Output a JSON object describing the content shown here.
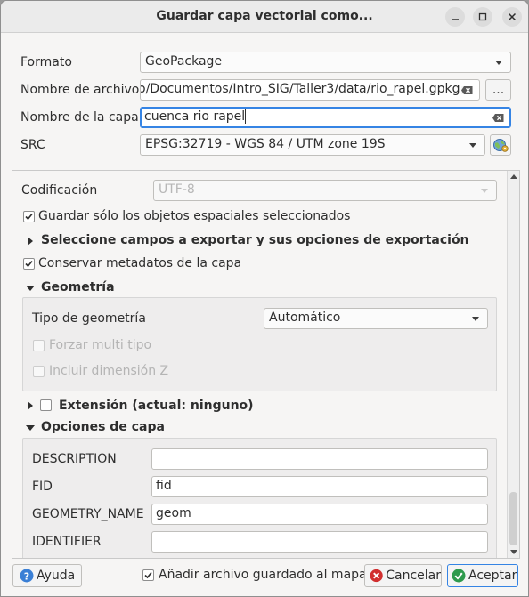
{
  "window": {
    "title": "Guardar capa vectorial como..."
  },
  "form": {
    "format_label": "Formato",
    "format_value": "GeoPackage",
    "filename_label": "Nombre de archivo",
    "filename_value": "o/Documentos/Intro_SIG/Taller3/data/rio_rapel.gpkg",
    "browse_label": "...",
    "layername_label": "Nombre de la capa",
    "layername_value": "cuenca rio rapel",
    "crs_label": "SRC",
    "crs_value": "EPSG:32719 - WGS 84 / UTM zone 19S"
  },
  "options": {
    "encoding_label": "Codificación",
    "encoding_value": "UTF-8",
    "selected_only_label": "Guardar sólo los objetos espaciales seleccionados",
    "selected_only_checked": true,
    "fields_section_label": "Seleccione campos a exportar y sus opciones de exportación",
    "keep_metadata_label": "Conservar metadatos de la capa",
    "keep_metadata_checked": true,
    "geometry_section_label": "Geometría",
    "geometry_type_label": "Tipo de geometría",
    "geometry_type_value": "Automático",
    "force_multi_label": "Forzar multi tipo",
    "include_z_label": "Incluir dimensión Z",
    "extent_section_label": "Extensión (actual: ninguno)",
    "layer_options_section_label": "Opciones de capa",
    "layer_options": [
      {
        "name": "DESCRIPTION",
        "value": ""
      },
      {
        "name": "FID",
        "value": "fid"
      },
      {
        "name": "GEOMETRY_NAME",
        "value": "geom"
      },
      {
        "name": "IDENTIFIER",
        "value": ""
      }
    ]
  },
  "footer": {
    "help_label": "Ayuda",
    "add_to_map_label": "Añadir archivo guardado al mapa",
    "add_to_map_checked": true,
    "cancel_label": "Cancelar",
    "accept_label": "Aceptar"
  },
  "colors": {
    "focus": "#3584e4",
    "help_icon": "#3a7fd5",
    "cancel_icon": "#d12f2f",
    "accept_icon": "#2d9a4c"
  }
}
